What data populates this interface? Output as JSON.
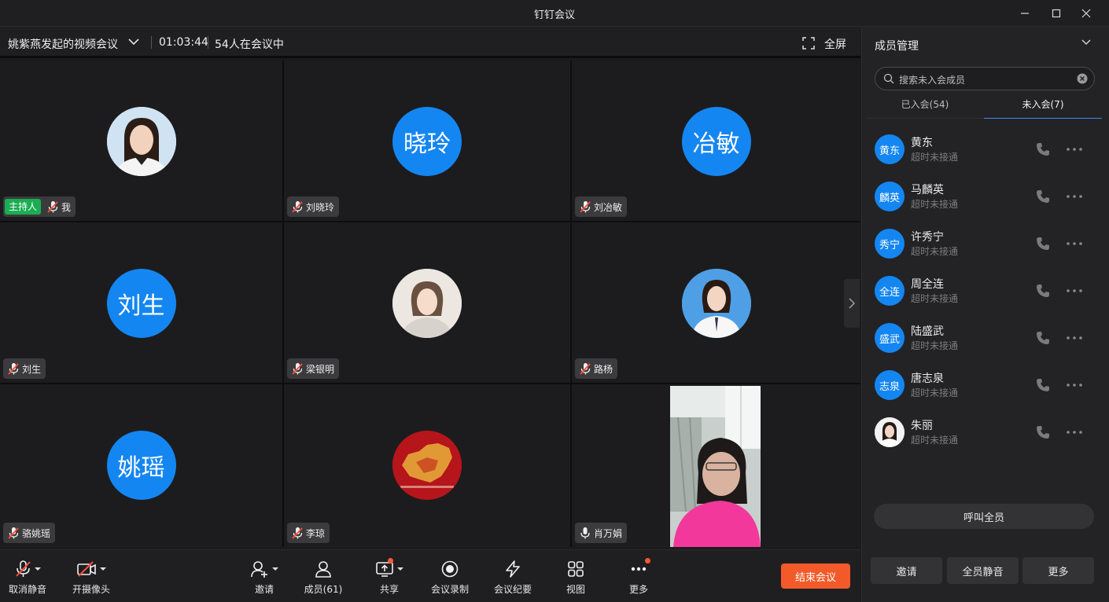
{
  "window": {
    "title": "钉钉会议"
  },
  "meeting": {
    "title": "姚紫燕发起的视频会议",
    "elapsed": "01:03:44",
    "participants_in_meeting": "54人在会议中",
    "fullscreen_label": "全屏"
  },
  "grid": {
    "host_badge": "主持人",
    "tiles": [
      {
        "name": "我",
        "avatar_text": "",
        "avatar_kind": "photo-woman",
        "mic": "muted"
      },
      {
        "name": "刘晓玲",
        "avatar_text": "晓玲",
        "mic": "muted"
      },
      {
        "name": "刘冶敏",
        "avatar_text": "冶敏",
        "mic": "muted"
      },
      {
        "name": "刘生",
        "avatar_text": "刘生",
        "mic": "muted"
      },
      {
        "name": "梁银明",
        "avatar_text": "",
        "avatar_kind": "photo-woman-light",
        "mic": "muted"
      },
      {
        "name": "路杨",
        "avatar_text": "",
        "avatar_kind": "photo-woman-blue",
        "mic": "muted"
      },
      {
        "name": "骆姚瑶",
        "avatar_text": "姚瑶",
        "mic": "muted"
      },
      {
        "name": "李琼",
        "avatar_text": "",
        "avatar_kind": "photo-map-red",
        "mic": "muted"
      },
      {
        "name": "肖万娟",
        "avatar_text": "",
        "avatar_kind": "live-video",
        "mic": "on"
      }
    ]
  },
  "toolbar": {
    "unmute": "取消静音",
    "camera": "开摄像头",
    "invite": "邀请",
    "members": "成员(61)",
    "share": "共享",
    "record": "会议录制",
    "minutes": "会议纪要",
    "view": "视图",
    "more": "更多",
    "end": "结束会议"
  },
  "panel": {
    "title": "成员管理",
    "search_placeholder": "搜索未入会成员",
    "tab_joined": "已入会(54)",
    "tab_not_joined": "未入会(7)",
    "members": [
      {
        "avatar_text": "黄东",
        "name": "黄东",
        "status": "超时未接通"
      },
      {
        "avatar_text": "麟英",
        "name": "马麟英",
        "status": "超时未接通"
      },
      {
        "avatar_text": "秀宁",
        "name": "许秀宁",
        "status": "超时未接通"
      },
      {
        "avatar_text": "全连",
        "name": "周全连",
        "status": "超时未接通"
      },
      {
        "avatar_text": "盛武",
        "name": "陆盛武",
        "status": "超时未接通"
      },
      {
        "avatar_text": "志泉",
        "name": "唐志泉",
        "status": "超时未接通"
      },
      {
        "avatar_text": "",
        "name": "朱丽",
        "status": "超时未接通",
        "avatar_kind": "photo-woman"
      }
    ],
    "call_all": "呼叫全员",
    "invite": "邀请",
    "mute_all": "全员静音",
    "more": "更多"
  },
  "colors": {
    "accent_blue": "#1486f2",
    "end_button": "#f25a2a",
    "host_badge": "#1aad52",
    "notify_dot": "#ff5a33"
  }
}
